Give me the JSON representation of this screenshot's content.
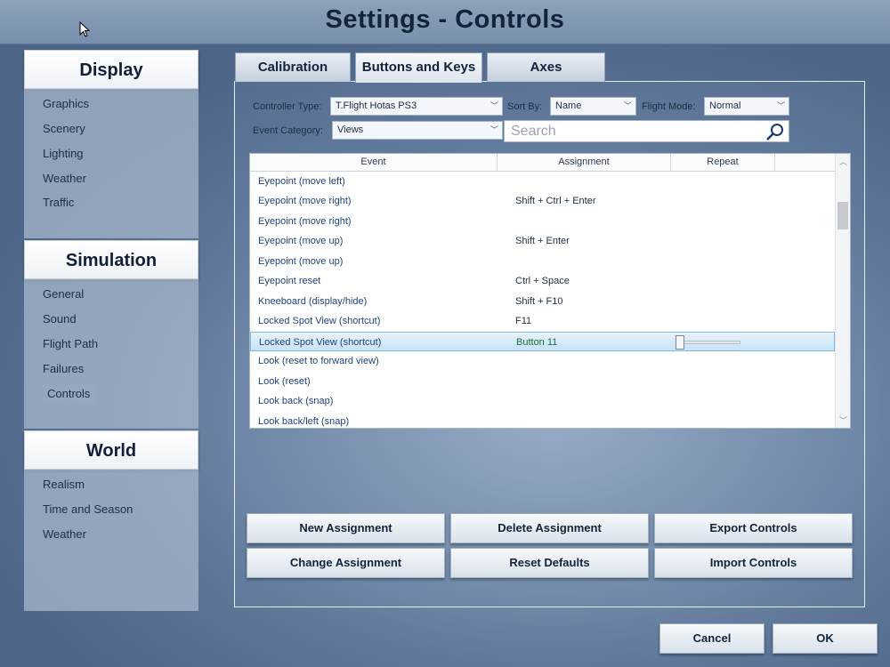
{
  "window": {
    "title": "Settings - Controls"
  },
  "sidebar": {
    "sections": [
      {
        "heading": "Display",
        "items": [
          "Graphics",
          "Scenery",
          "Lighting",
          "Weather",
          "Traffic"
        ]
      },
      {
        "heading": "Simulation",
        "items": [
          "General",
          "Sound",
          "Flight Path",
          "Failures",
          "Controls"
        ]
      },
      {
        "heading": "World",
        "items": [
          "Realism",
          "Time and Season",
          "Weather"
        ]
      }
    ],
    "active_item": "Controls"
  },
  "tabs": [
    {
      "label": "Calibration"
    },
    {
      "label": "Buttons and Keys",
      "selected": true
    },
    {
      "label": "Axes"
    }
  ],
  "filters": {
    "controller_type_label": "Controller Type:",
    "controller_type_value": "T.Flight Hotas PS3",
    "sort_by_label": "Sort By:",
    "sort_by_value": "Name",
    "flight_mode_label": "Flight Mode:",
    "flight_mode_value": "Normal",
    "event_category_label": "Event Category:",
    "event_category_value": "Views",
    "search_placeholder": "Search"
  },
  "table": {
    "columns": [
      "Event",
      "Assignment",
      "Repeat"
    ],
    "rows": [
      {
        "event": "Eyepoint (move left)",
        "assignment": ""
      },
      {
        "event": "Eyepoint (move right)",
        "assignment": "Shift + Ctrl + Enter"
      },
      {
        "event": "Eyepoint (move right)",
        "assignment": ""
      },
      {
        "event": "Eyepoint (move up)",
        "assignment": "Shift + Enter"
      },
      {
        "event": "Eyepoint (move up)",
        "assignment": ""
      },
      {
        "event": "Eyepoint reset",
        "assignment": "Ctrl + Space"
      },
      {
        "event": "Kneeboard (display/hide)",
        "assignment": "Shift + F10"
      },
      {
        "event": "Locked Spot View (shortcut)",
        "assignment": "F11"
      },
      {
        "event": "Locked Spot View (shortcut)",
        "assignment": "Button 11",
        "selected": true,
        "repeat_level": 0
      },
      {
        "event": "Look (reset to forward view)",
        "assignment": ""
      },
      {
        "event": "Look (reset)",
        "assignment": ""
      },
      {
        "event": "Look back (snap)",
        "assignment": ""
      },
      {
        "event": "Look back/left (snap)",
        "assignment": ""
      }
    ]
  },
  "actions": {
    "new_assignment": "New Assignment",
    "delete_assignment": "Delete Assignment",
    "export_controls": "Export Controls",
    "change_assignment": "Change Assignment",
    "reset_defaults": "Reset Defaults",
    "import_controls": "Import Controls"
  },
  "footer": {
    "cancel": "Cancel",
    "ok": "OK"
  }
}
